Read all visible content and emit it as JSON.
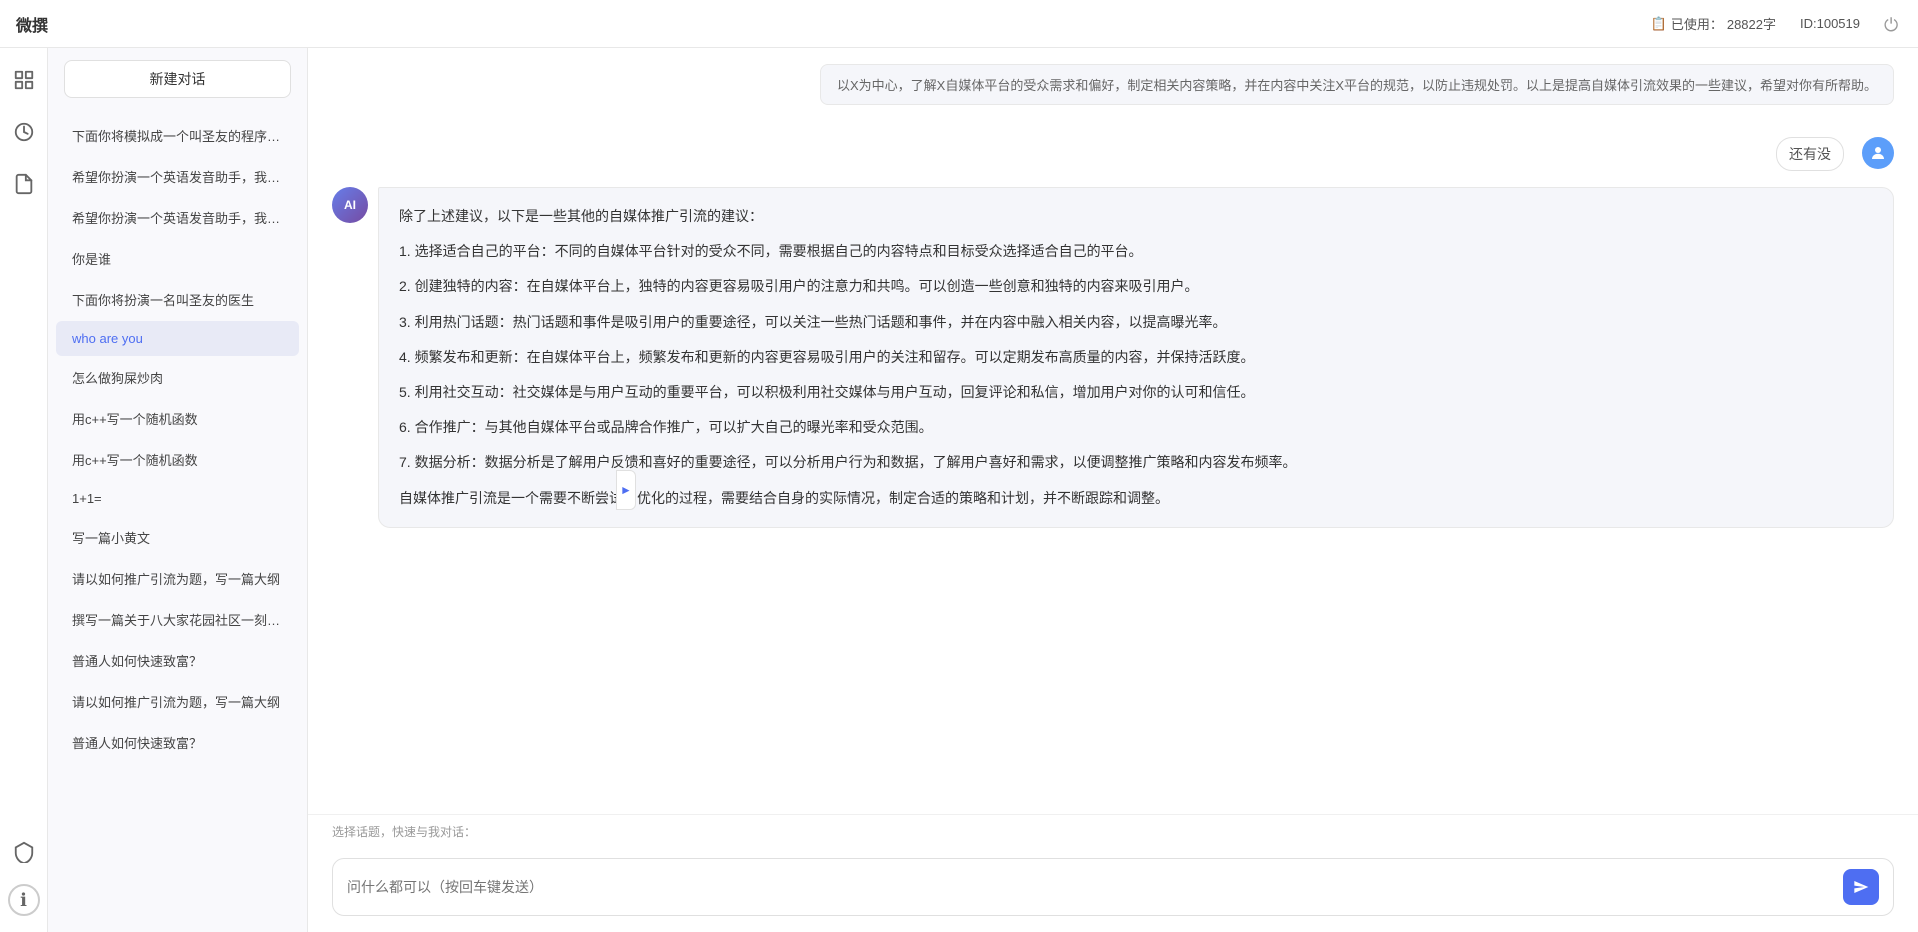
{
  "topbar": {
    "logo": "微撰",
    "usage_label": "已使用：",
    "usage_value": "28822字",
    "id_label": "ID:100519",
    "usage_icon": "📋"
  },
  "icon_rail": {
    "items": [
      {
        "id": "home",
        "icon": "⊞",
        "active": false
      },
      {
        "id": "clock",
        "icon": "◷",
        "active": false
      },
      {
        "id": "doc",
        "icon": "📄",
        "active": false
      }
    ],
    "bottom_items": [
      {
        "id": "shield",
        "icon": "🛡"
      },
      {
        "id": "info",
        "icon": "ℹ"
      }
    ]
  },
  "sidebar": {
    "new_btn_label": "新建对话",
    "items": [
      {
        "id": 1,
        "text": "下面你将模拟成一个叫圣友的程序员，我说...",
        "active": false
      },
      {
        "id": 2,
        "text": "希望你扮演一个英语发音助手，我提供给你...",
        "active": false
      },
      {
        "id": 3,
        "text": "希望你扮演一个英语发音助手，我提供给你...",
        "active": false
      },
      {
        "id": 4,
        "text": "你是谁",
        "active": false
      },
      {
        "id": 5,
        "text": "下面你将扮演一名叫圣友的医生",
        "active": false
      },
      {
        "id": 6,
        "text": "who are you",
        "active": true
      },
      {
        "id": 7,
        "text": "怎么做狗屎炒肉",
        "active": false
      },
      {
        "id": 8,
        "text": "用c++写一个随机函数",
        "active": false
      },
      {
        "id": 9,
        "text": "用c++写一个随机函数",
        "active": false
      },
      {
        "id": 10,
        "text": "1+1=",
        "active": false
      },
      {
        "id": 11,
        "text": "写一篇小黄文",
        "active": false
      },
      {
        "id": 12,
        "text": "请以如何推广引流为题，写一篇大纲",
        "active": false
      },
      {
        "id": 13,
        "text": "撰写一篇关于八大家花园社区一刻钟便民生...",
        "active": false
      },
      {
        "id": 14,
        "text": "普通人如何快速致富？",
        "active": false
      },
      {
        "id": 15,
        "text": "请以如何推广引流为题，写一篇大纲",
        "active": false
      },
      {
        "id": 16,
        "text": "普通人如何快速致富？",
        "active": false
      }
    ]
  },
  "chat": {
    "truncated_msg": "以X为中心，了解X自媒体平台的受众需求和偏好，制定相关内容策略，并在内容中关注X平台的规范，以防止违规处罚。以上是提高自媒体引流效果的一些建议，希望对你有所帮助。",
    "user_msg_1": "还有没",
    "ai_response": {
      "paragraphs": [
        "除了上述建议，以下是一些其他的自媒体推广引流的建议：",
        "1. 选择适合自己的平台：不同的自媒体平台针对的受众不同，需要根据自己的内容特点和目标受众选择适合自己的平台。",
        "2. 创建独特的内容：在自媒体平台上，独特的内容更容易吸引用户的注意力和共鸣。可以创造一些创意和独特的内容来吸引用户。",
        "3. 利用热门话题：热门话题和事件是吸引用户的重要途径，可以关注一些热门话题和事件，并在内容中融入相关内容，以提高曝光率。",
        "4. 频繁发布和更新：在自媒体平台上，频繁发布和更新的内容更容易吸引用户的关注和留存。可以定期发布高质量的内容，并保持活跃度。",
        "5. 利用社交互动：社交媒体是与用户互动的重要平台，可以积极利用社交媒体与用户互动，回复评论和私信，增加用户对你的认可和信任。",
        "6. 合作推广：与其他自媒体平台或品牌合作推广，可以扩大自己的曝光率和受众范围。",
        "7. 数据分析：数据分析是了解用户反馈和喜好的重要途径，可以分析用户行为和数据，了解用户喜好和需求，以便调整推广策略和内容发布频率。",
        "自媒体推广引流是一个需要不断尝试和优化的过程，需要结合自身的实际情况，制定合适的策略和计划，并不断跟踪和调整。"
      ]
    },
    "quick_select_label": "选择话题，快速与我对话：",
    "input_placeholder": "问什么都可以（按回车键发送）",
    "send_icon": "➤"
  }
}
